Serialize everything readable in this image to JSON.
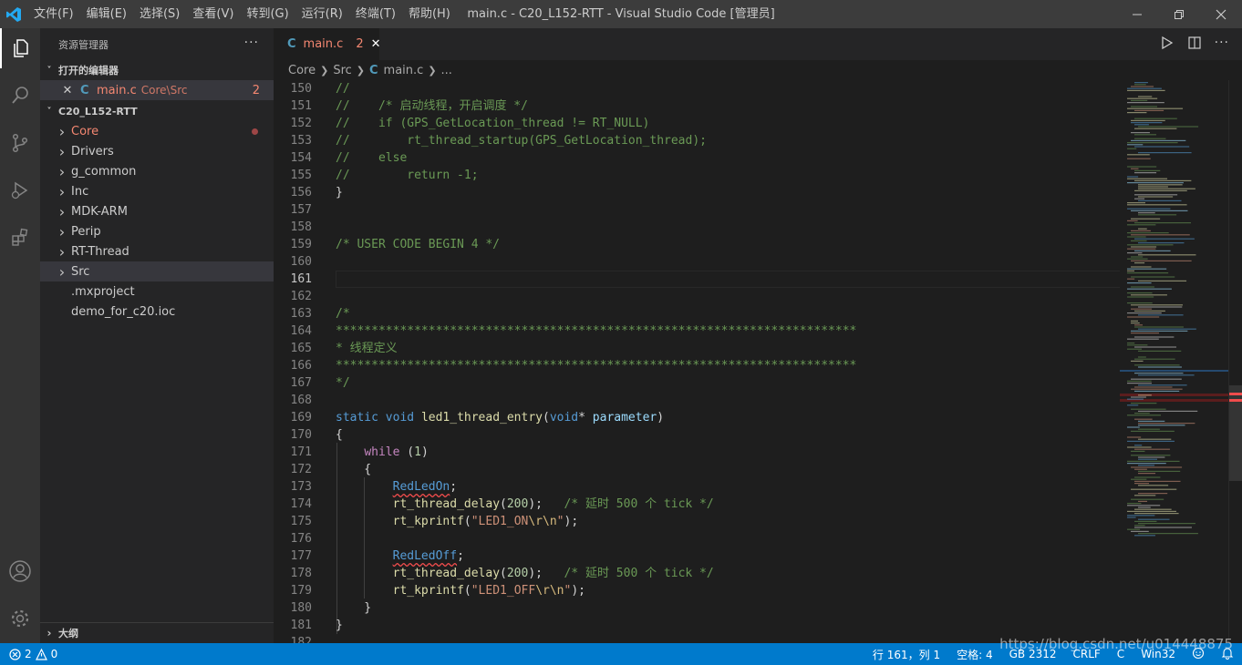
{
  "titlebar": {
    "menu": [
      "文件(F)",
      "编辑(E)",
      "选择(S)",
      "查看(V)",
      "转到(G)",
      "运行(R)",
      "终端(T)",
      "帮助(H)"
    ],
    "title": "main.c - C20_L152-RTT - Visual Studio Code [管理员]"
  },
  "sidebar": {
    "header": "资源管理器",
    "more": "···",
    "open_editors": {
      "label": "打开的编辑器",
      "file": "main.c",
      "path": "Core\\Src",
      "problems": "2",
      "icon": "C"
    },
    "project": {
      "label": "C20_L152-RTT",
      "items": [
        {
          "label": "Core",
          "type": "folder",
          "modified": true
        },
        {
          "label": "Drivers",
          "type": "folder"
        },
        {
          "label": "g_common",
          "type": "folder"
        },
        {
          "label": "Inc",
          "type": "folder"
        },
        {
          "label": "MDK-ARM",
          "type": "folder"
        },
        {
          "label": "Perip",
          "type": "folder"
        },
        {
          "label": "RT-Thread",
          "type": "folder"
        },
        {
          "label": "Src",
          "type": "folder",
          "selected": true
        },
        {
          "label": ".mxproject",
          "type": "file"
        },
        {
          "label": "demo_for_c20.ioc",
          "type": "file"
        }
      ]
    },
    "outline_label": "大纲"
  },
  "editor": {
    "tab": {
      "label": "main.c",
      "icon": "C",
      "problems": "2"
    },
    "breadcrumb": [
      "Core",
      "Src",
      "main.c",
      "..."
    ],
    "current_line": 161,
    "lines": [
      {
        "n": 150,
        "tokens": [
          [
            "cm",
            "//"
          ]
        ]
      },
      {
        "n": 151,
        "tokens": [
          [
            "cm",
            "//    /* 启动线程，开启调度 */"
          ]
        ]
      },
      {
        "n": 152,
        "tokens": [
          [
            "cm",
            "//    if (GPS_GetLocation_thread != RT_NULL)"
          ]
        ]
      },
      {
        "n": 153,
        "tokens": [
          [
            "cm",
            "//        rt_thread_startup(GPS_GetLocation_thread);"
          ]
        ]
      },
      {
        "n": 154,
        "tokens": [
          [
            "cm",
            "//    else"
          ]
        ]
      },
      {
        "n": 155,
        "tokens": [
          [
            "cm",
            "//        return -1;"
          ]
        ]
      },
      {
        "n": 156,
        "tokens": [
          [
            "p",
            "}"
          ]
        ]
      },
      {
        "n": 157,
        "tokens": []
      },
      {
        "n": 158,
        "tokens": []
      },
      {
        "n": 159,
        "tokens": [
          [
            "cm",
            "/* USER CODE BEGIN 4 */"
          ]
        ]
      },
      {
        "n": 160,
        "tokens": []
      },
      {
        "n": 161,
        "tokens": []
      },
      {
        "n": 162,
        "tokens": []
      },
      {
        "n": 163,
        "tokens": [
          [
            "cm",
            "/*"
          ]
        ]
      },
      {
        "n": 164,
        "tokens": [
          [
            "cm",
            "*************************************************************************"
          ]
        ]
      },
      {
        "n": 165,
        "tokens": [
          [
            "cm",
            "* 线程定义"
          ]
        ]
      },
      {
        "n": 166,
        "tokens": [
          [
            "cm",
            "*************************************************************************"
          ]
        ]
      },
      {
        "n": 167,
        "tokens": [
          [
            "cm",
            "*/"
          ]
        ]
      },
      {
        "n": 168,
        "tokens": []
      },
      {
        "n": 169,
        "tokens": [
          [
            "kw",
            "static"
          ],
          [
            "p",
            " "
          ],
          [
            "kw",
            "void"
          ],
          [
            "p",
            " "
          ],
          [
            "fn",
            "led1_thread_entry"
          ],
          [
            "p",
            "("
          ],
          [
            "kw",
            "void"
          ],
          [
            "p",
            "* "
          ],
          [
            "var",
            "parameter"
          ],
          [
            "p",
            ")"
          ]
        ]
      },
      {
        "n": 170,
        "tokens": [
          [
            "p",
            "{"
          ]
        ]
      },
      {
        "n": 171,
        "tokens": [
          [
            "p",
            "    "
          ],
          [
            "ctl",
            "while"
          ],
          [
            "p",
            " ("
          ],
          [
            "num",
            "1"
          ],
          [
            "p",
            ")"
          ]
        ]
      },
      {
        "n": 172,
        "tokens": [
          [
            "p",
            "    {"
          ]
        ]
      },
      {
        "n": 173,
        "tokens": [
          [
            "p",
            "        "
          ],
          [
            "mac",
            "RedLedOn"
          ],
          [
            "p",
            ";"
          ]
        ]
      },
      {
        "n": 174,
        "tokens": [
          [
            "p",
            "        "
          ],
          [
            "fn",
            "rt_thread_delay"
          ],
          [
            "p",
            "("
          ],
          [
            "num",
            "200"
          ],
          [
            "p",
            ");   "
          ],
          [
            "cm",
            "/* 延时 500 个 tick */"
          ]
        ]
      },
      {
        "n": 175,
        "tokens": [
          [
            "p",
            "        "
          ],
          [
            "fn",
            "rt_kprintf"
          ],
          [
            "p",
            "("
          ],
          [
            "str",
            "\"LED1_ON"
          ],
          [
            "esc",
            "\\r\\n"
          ],
          [
            "str",
            "\""
          ],
          [
            "p",
            ");"
          ]
        ]
      },
      {
        "n": 176,
        "tokens": []
      },
      {
        "n": 177,
        "tokens": [
          [
            "p",
            "        "
          ],
          [
            "mac",
            "RedLedOff"
          ],
          [
            "p",
            ";"
          ]
        ]
      },
      {
        "n": 178,
        "tokens": [
          [
            "p",
            "        "
          ],
          [
            "fn",
            "rt_thread_delay"
          ],
          [
            "p",
            "("
          ],
          [
            "num",
            "200"
          ],
          [
            "p",
            ");   "
          ],
          [
            "cm",
            "/* 延时 500 个 tick */"
          ]
        ]
      },
      {
        "n": 179,
        "tokens": [
          [
            "p",
            "        "
          ],
          [
            "fn",
            "rt_kprintf"
          ],
          [
            "p",
            "("
          ],
          [
            "str",
            "\"LED1_OFF"
          ],
          [
            "esc",
            "\\r\\n"
          ],
          [
            "str",
            "\""
          ],
          [
            "p",
            ");"
          ]
        ]
      },
      {
        "n": 180,
        "tokens": [
          [
            "p",
            "    }"
          ]
        ]
      },
      {
        "n": 181,
        "tokens": [
          [
            "p",
            "}"
          ]
        ]
      },
      {
        "n": 182,
        "tokens": []
      }
    ]
  },
  "statusbar": {
    "errors": "2",
    "warnings": "0",
    "position": "行 161，列 1",
    "spaces": "空格: 4",
    "encoding": "GB 2312",
    "eol": "CRLF",
    "language": "C",
    "platform": "Win32"
  },
  "watermark": "https://blog.csdn.net/u014448875",
  "colors": {
    "accent": "#007acc",
    "error": "#f14c4c",
    "comment": "#6a9955",
    "keyword": "#569cd6",
    "function": "#dcdcaa"
  }
}
